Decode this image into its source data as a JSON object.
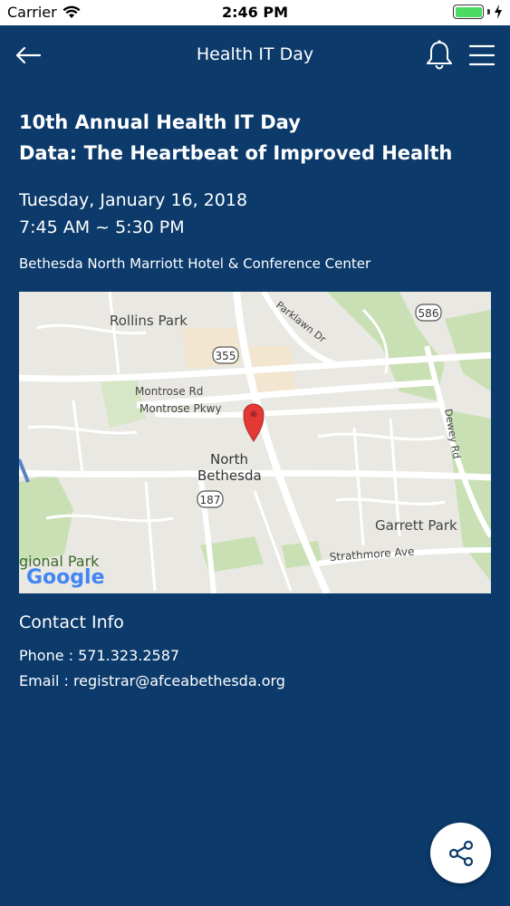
{
  "status_bar": {
    "carrier": "Carrier",
    "time": "2:46 PM",
    "icons": [
      "wifi-icon",
      "battery-icon",
      "charging-icon"
    ]
  },
  "nav": {
    "title": "Health IT Day",
    "icons": [
      "back-arrow-icon",
      "bell-icon",
      "menu-icon"
    ]
  },
  "event": {
    "title_line1": "10th Annual Health IT Day",
    "title_line2": "Data: The Heartbeat of Improved Health",
    "date": "Tuesday, January 16, 2018",
    "time": "7:45 AM ~ 5:30 PM",
    "venue": "Bethesda North Marriott Hotel & Conference Center"
  },
  "map": {
    "labels": {
      "rollins_park": "Rollins Park",
      "parklawn_dr": "Parklawn Dr",
      "route_586": "586",
      "route_355": "355",
      "montrose_rd": "Montrose Rd",
      "montrose_pkwy": "Montrose Pkwy",
      "dewey_rd": "Dewey Rd",
      "north": "North",
      "bethesda": "Bethesda",
      "route_187": "187",
      "garrett_park": "Garrett Park",
      "strathmore_ave": "Strathmore Ave",
      "regional_park": "gional Park",
      "google": "Google"
    },
    "colors": {
      "land": "#eae8e2",
      "park": "#c8e0b4",
      "road": "#ffffff",
      "highway": "#f3d9a3",
      "pin": "#e53935"
    }
  },
  "contact": {
    "heading": "Contact Info",
    "phone": "Phone : 571.323.2587",
    "email": "Email : registrar@afceabethesda.org"
  },
  "fab": {
    "icon": "share-icon"
  },
  "colors": {
    "background": "#0b3a6b",
    "text": "#ffffff"
  }
}
